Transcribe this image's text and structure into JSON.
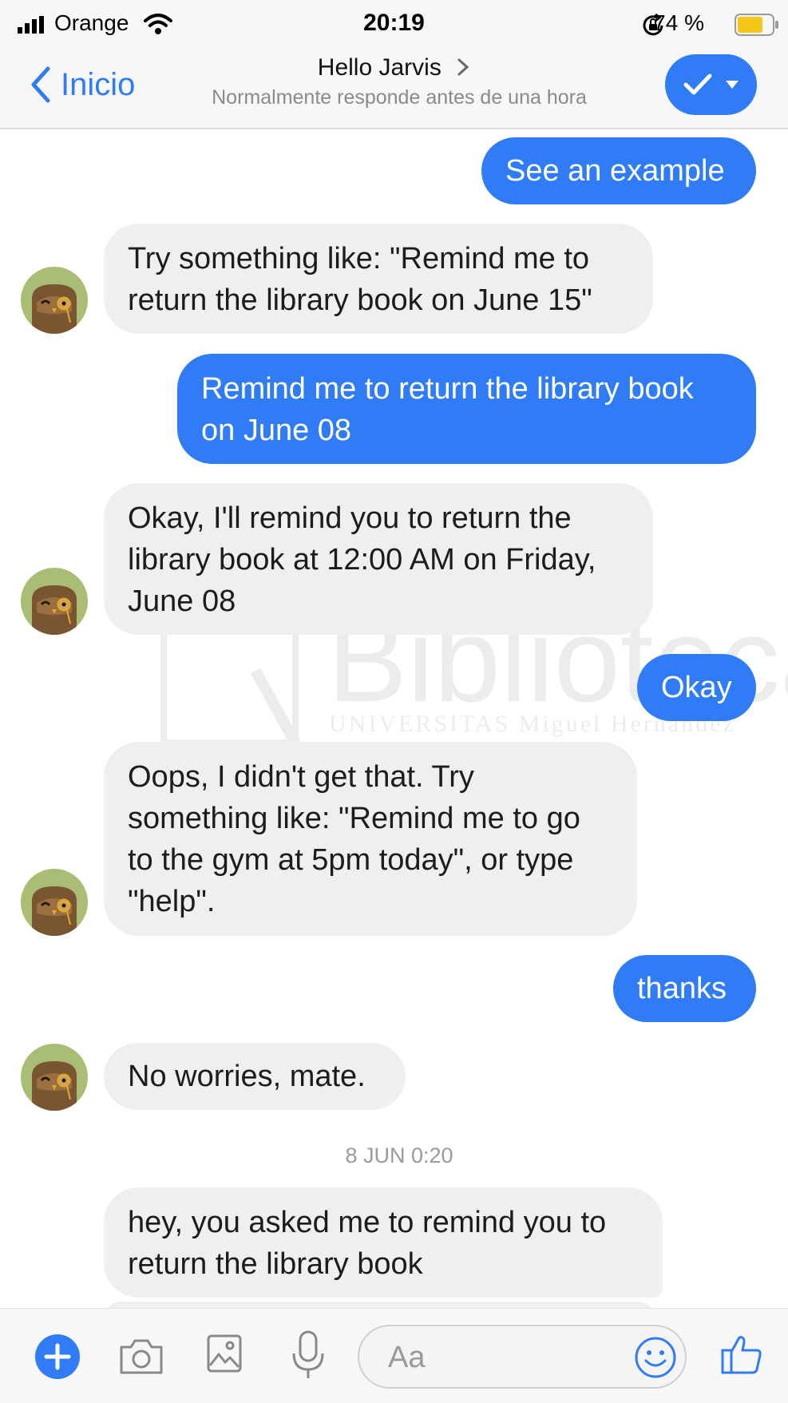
{
  "status_bar": {
    "carrier": "Orange",
    "time": "20:19",
    "battery_percent": "74 %",
    "icons": [
      "signal-icon",
      "wifi-icon",
      "rotation-lock-icon",
      "battery-icon"
    ]
  },
  "header": {
    "back_label": "Inicio",
    "title": "Hello Jarvis",
    "subtitle": "Normalmente responde antes de una hora",
    "accent_color": "#2f7cf6"
  },
  "messages": [
    {
      "from": "user",
      "text": "See an example"
    },
    {
      "from": "bot",
      "lines": [
        "Try something like: \"Remind me to",
        "return the library book on June 15\""
      ]
    },
    {
      "from": "user",
      "lines": [
        "Remind me to return the library book",
        "on June 08"
      ]
    },
    {
      "from": "bot",
      "lines": [
        "Okay, I'll remind you to return the",
        "library book at 12:00 AM on Friday,",
        "June 08"
      ]
    },
    {
      "from": "user",
      "text": "Okay"
    },
    {
      "from": "bot",
      "lines": [
        "Oops, I didn't get that. Try",
        "something like: \"Remind me to go",
        "to the gym at 5pm today\", or type",
        "\"help\"."
      ]
    },
    {
      "from": "user",
      "text": "thanks"
    },
    {
      "from": "bot",
      "text": "No worries, mate."
    },
    {
      "from": "bot",
      "lines": [
        "hey, you asked me to remind you to",
        "return the library book"
      ]
    }
  ],
  "timestamp": "8 JUN 0:20",
  "watermark": {
    "title": "Biblioteca",
    "subtitle": "UNIVERSITAS Miguel Hernández"
  },
  "composer": {
    "placeholder": "Aa",
    "icons": [
      "plus-icon",
      "camera-icon",
      "image-icon",
      "microphone-icon",
      "emoji-icon",
      "thumbs-up-icon"
    ]
  }
}
